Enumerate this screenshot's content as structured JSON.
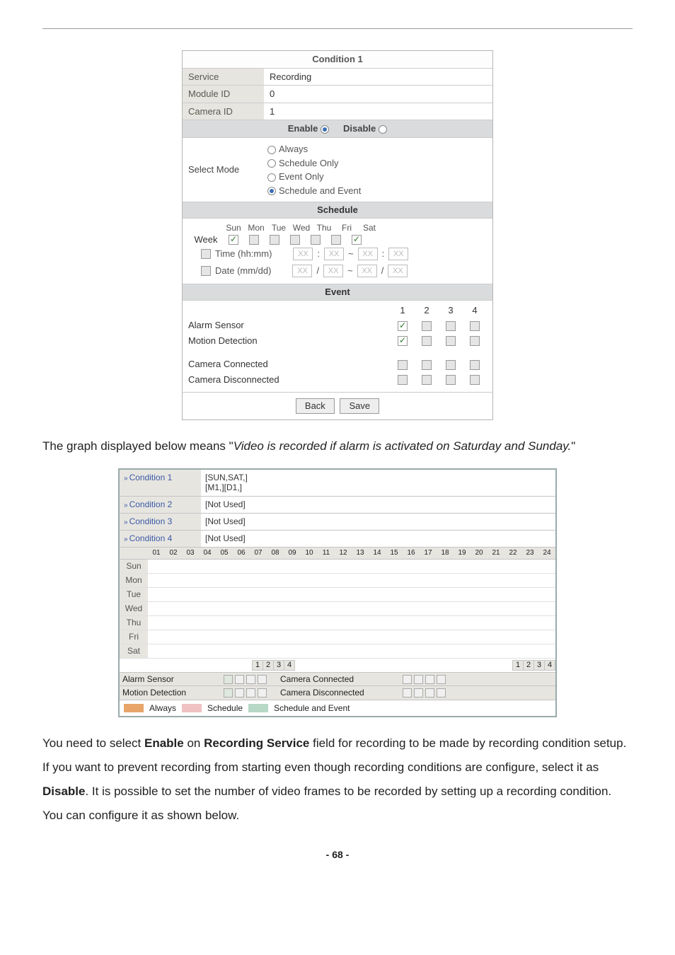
{
  "cond_panel": {
    "title": "Condition 1",
    "rows": {
      "service_l": "Service",
      "service_v": "Recording",
      "module_l": "Module ID",
      "module_v": "0",
      "camera_l": "Camera ID",
      "camera_v": "1"
    },
    "enable_l": "Enable",
    "disable_l": "Disable",
    "select_mode_l": "Select Mode",
    "modes": {
      "always": "Always",
      "sched": "Schedule Only",
      "event": "Event Only",
      "both": "Schedule and Event"
    },
    "schedule_head": "Schedule",
    "week_l": "Week",
    "days": [
      "Sun",
      "Mon",
      "Tue",
      "Wed",
      "Thu",
      "Fri",
      "Sat"
    ],
    "time_l": "Time (hh:mm)",
    "date_l": "Date (mm/dd)",
    "xx": "XX",
    "event_head": "Event",
    "ev_nums": [
      "1",
      "2",
      "3",
      "4"
    ],
    "alarm_l": "Alarm Sensor",
    "motion_l": "Motion Detection",
    "cam_con_l": "Camera Connected",
    "cam_dis_l": "Camera Disconnected",
    "back_btn": "Back",
    "save_btn": "Save"
  },
  "note1_a": "The graph displayed below means \"",
  "note1_b": "Video is recorded if alarm is activated on Saturday and Sunday.",
  "note1_c": "\"",
  "sched_table": {
    "c1_l": "Condition 1",
    "c1_v": "[SUN,SAT,]\n[M1,][D1,]",
    "c2_l": "Condition 2",
    "c2_v": "[Not Used]",
    "c3_l": "Condition 3",
    "c3_v": "[Not Used]",
    "c4_l": "Condition 4",
    "c4_v": "[Not Used]",
    "hours": [
      "01",
      "02",
      "03",
      "04",
      "05",
      "06",
      "07",
      "08",
      "09",
      "10",
      "11",
      "12",
      "13",
      "14",
      "15",
      "16",
      "17",
      "18",
      "19",
      "20",
      "21",
      "22",
      "23",
      "24"
    ],
    "days": [
      "Sun",
      "Mon",
      "Tue",
      "Wed",
      "Thu",
      "Fri",
      "Sat"
    ],
    "nums": [
      "1",
      "2",
      "3",
      "4"
    ],
    "alarm_l": "Alarm Sensor",
    "motion_l": "Motion Detection",
    "cam_con_l": "Camera Connected",
    "cam_dis_l": "Camera Disconnected",
    "leg_always": "Always",
    "leg_sched": "Schedule",
    "leg_both": "Schedule and Event"
  },
  "para2_a": "You need to select ",
  "para2_b": "Enable",
  "para2_c": " on ",
  "para2_d": "Recording Service",
  "para2_e": " field for recording to be made by recording condition setup. If you want to prevent recording from starting even though recording conditions are configure, select it as ",
  "para2_f": "Disable",
  "para2_g": ". It is possible to set the number of video frames to be recorded by setting up a recording condition. You can configure it as shown below.",
  "page_no": "- 68 -",
  "chart_data": {
    "type": "table",
    "title": "Recording schedule by day/hour (no cells filled in this figure)",
    "days": [
      "Sun",
      "Mon",
      "Tue",
      "Wed",
      "Thu",
      "Fri",
      "Sat"
    ],
    "hours_range": [
      1,
      24
    ],
    "note": "Legend colors: Always=orange, Schedule=pink, Schedule and Event=teal. The grid in this screenshot shows no colored cells."
  }
}
